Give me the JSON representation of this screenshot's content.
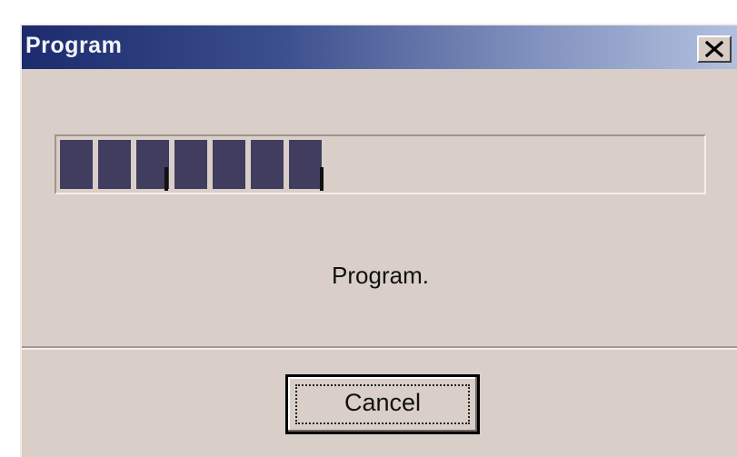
{
  "dialog": {
    "title": "Program",
    "close_icon": "close-icon",
    "progress": {
      "filled_segments": 7,
      "fraction": 0.41
    },
    "status_text": "Program.",
    "cancel_label": "Cancel"
  },
  "colors": {
    "title_gradient_start": "#1c2b6e",
    "title_gradient_end": "#b3c1df",
    "dialog_background": "#d9cfc8",
    "progress_segment": "#403d5f"
  }
}
